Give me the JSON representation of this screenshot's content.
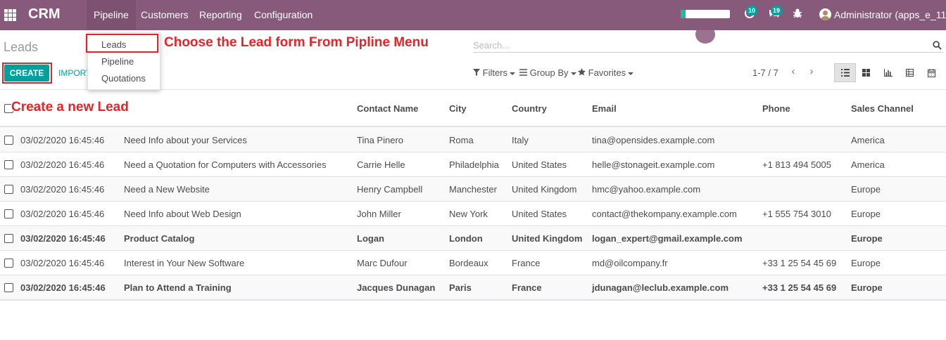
{
  "navbar": {
    "app_title": "CRM",
    "menu": [
      "Pipeline",
      "Customers",
      "Reporting",
      "Configuration"
    ],
    "activity_count": "10",
    "message_count": "19",
    "user": "Administrator (apps_e_11)",
    "onboarding_progress": 0.1
  },
  "control_panel": {
    "breadcrumb": "Leads",
    "search_placeholder": "Search...",
    "create_label": "CREATE",
    "import_label": "IMPORT",
    "filters_label": "Filters",
    "groupby_label": "Group By",
    "favorites_label": "Favorites",
    "pager": "1-7 / 7",
    "views": [
      "list-icon",
      "kanban-icon",
      "graph-icon",
      "pivot-icon",
      "calendar-icon"
    ]
  },
  "pipeline_dropdown": {
    "items": [
      "Leads",
      "Pipeline",
      "Quotations"
    ]
  },
  "annotations": {
    "leads_note": "Choose the Lead form From Pipline Menu",
    "create_note": "Create a new Lead"
  },
  "table": {
    "columns": [
      "",
      "",
      "Contact Name",
      "City",
      "Country",
      "Email",
      "Phone",
      "Sales Channel"
    ],
    "rows": [
      {
        "date": "03/02/2020 16:45:46",
        "name": "Need Info about your Services",
        "contact": "Tina Pinero",
        "city": "Roma",
        "country": "Italy",
        "email": "tina@opensides.example.com",
        "phone": "",
        "channel": "America",
        "bold": false
      },
      {
        "date": "03/02/2020 16:45:46",
        "name": "Need a Quotation for Computers with Accessories",
        "contact": "Carrie Helle",
        "city": "Philadelphia",
        "country": "United States",
        "email": "helle@stonageit.example.com",
        "phone": "+1 813 494 5005",
        "channel": "America",
        "bold": false
      },
      {
        "date": "03/02/2020 16:45:46",
        "name": "Need a New Website",
        "contact": "Henry Campbell",
        "city": "Manchester",
        "country": "United Kingdom",
        "email": "hmc@yahoo.example.com",
        "phone": "",
        "channel": "Europe",
        "bold": false
      },
      {
        "date": "03/02/2020 16:45:46",
        "name": "Need Info about Web Design",
        "contact": "John Miller",
        "city": "New York",
        "country": "United States",
        "email": "contact@thekompany.example.com",
        "phone": "+1 555 754 3010",
        "channel": "Europe",
        "bold": false
      },
      {
        "date": "03/02/2020 16:45:46",
        "name": "Product Catalog",
        "contact": "Logan",
        "city": "London",
        "country": "United Kingdom",
        "email": "logan_expert@gmail.example.com",
        "phone": "",
        "channel": "Europe",
        "bold": true
      },
      {
        "date": "03/02/2020 16:45:46",
        "name": "Interest in Your New Software",
        "contact": "Marc Dufour",
        "city": "Bordeaux",
        "country": "France",
        "email": "md@oilcompany.fr",
        "phone": "+33 1 25 54 45 69",
        "channel": "Europe",
        "bold": false
      },
      {
        "date": "03/02/2020 16:45:46",
        "name": "Plan to Attend a Training",
        "contact": "Jacques Dunagan",
        "city": "Paris",
        "country": "France",
        "email": "jdunagan@leclub.example.com",
        "phone": "+33 1 25 54 45 69",
        "channel": "Europe",
        "bold": true
      }
    ]
  },
  "colors": {
    "navbar": "#875a7b",
    "primary": "#00a09d",
    "annotation": "#e0262b"
  }
}
